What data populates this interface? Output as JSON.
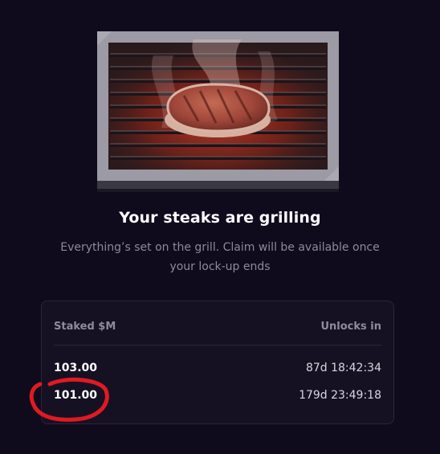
{
  "hero": {
    "title": "Your steaks are grilling",
    "subtitle": "Everything’s set on the grill. Claim will be available once your lock-up ends"
  },
  "stakes_table": {
    "headers": {
      "staked": "Staked $M",
      "unlocks": "Unlocks in"
    },
    "rows": [
      {
        "amount": "103.00",
        "unlocks_in": "87d 18:42:34"
      },
      {
        "amount": "101.00",
        "unlocks_in": "179d 23:49:18"
      }
    ]
  },
  "colors": {
    "background": "#0f0a1c",
    "card_background": "#161122",
    "annotation": "#e01a22"
  },
  "icons": {
    "grill_illustration": "grill-with-steak-icon",
    "annotation_circle": "red-hand-drawn-circle"
  }
}
